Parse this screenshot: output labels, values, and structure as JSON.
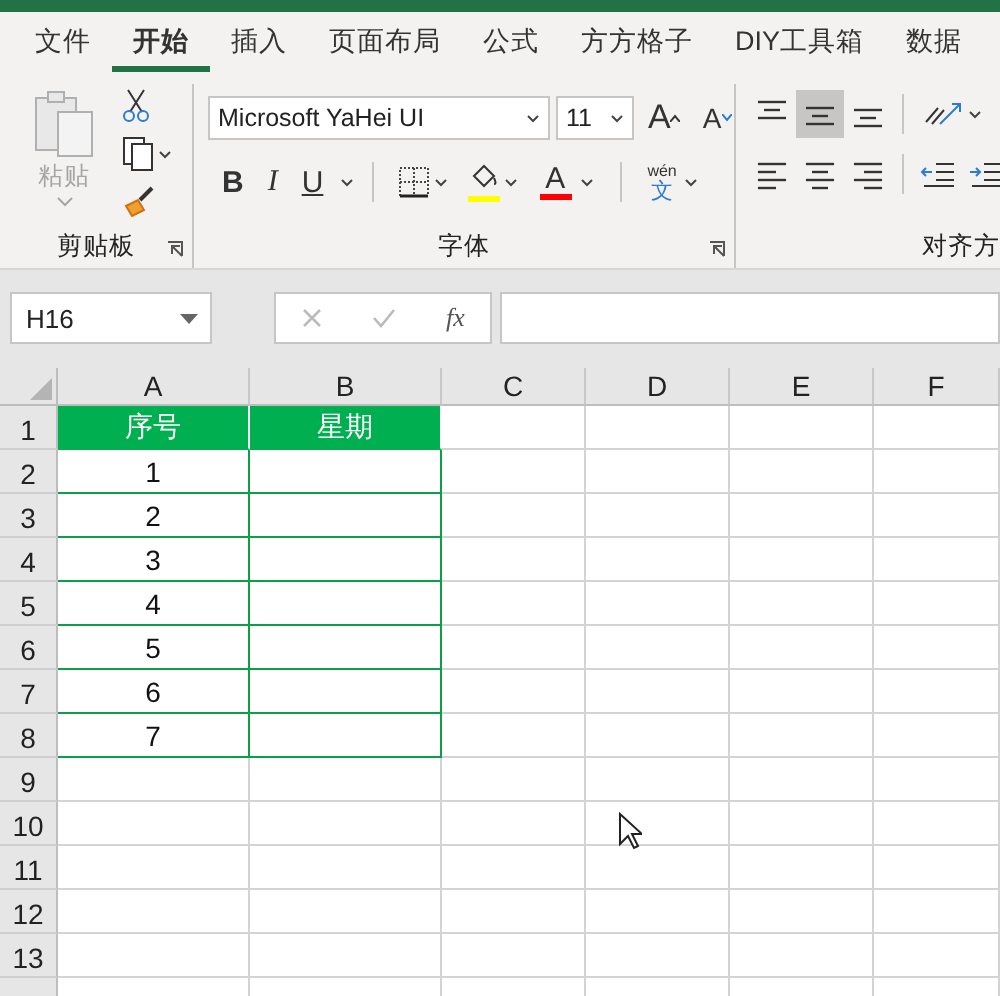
{
  "tabs": [
    {
      "label": "文件",
      "selected": false
    },
    {
      "label": "开始",
      "selected": true
    },
    {
      "label": "插入",
      "selected": false
    },
    {
      "label": "页面布局",
      "selected": false
    },
    {
      "label": "公式",
      "selected": false
    },
    {
      "label": "方方格子",
      "selected": false
    },
    {
      "label": "DIY工具箱",
      "selected": false
    },
    {
      "label": "数据",
      "selected": false
    }
  ],
  "clipboard": {
    "paste": {
      "label": "粘贴",
      "disabled": true
    },
    "title": "剪贴板"
  },
  "font": {
    "name": "Microsoft YaHei UI",
    "size": "11",
    "grow": "A",
    "shrink": "A",
    "bold": "B",
    "italic": "I",
    "underline": "U",
    "font_color": "A",
    "phonetic_top": "wén",
    "phonetic_main": "文",
    "title": "字体"
  },
  "alignment": {
    "vertical": [
      {
        "kind": "top",
        "selected": false
      },
      {
        "kind": "middle",
        "selected": true
      },
      {
        "kind": "bottom",
        "selected": false
      }
    ],
    "horizontal": [
      {
        "kind": "left",
        "selected": false
      },
      {
        "kind": "center",
        "selected": false
      },
      {
        "kind": "right",
        "selected": false
      }
    ],
    "title": "对齐方"
  },
  "formula_bar": {
    "name_box": "H16",
    "fx": "fx"
  },
  "sheet": {
    "columns": [
      "A",
      "B",
      "C",
      "D",
      "E",
      "F"
    ],
    "rows": [
      {
        "header": "1",
        "kind": "header",
        "cells": [
          "序号",
          "星期"
        ]
      },
      {
        "header": "2",
        "kind": "data",
        "cells": [
          "1",
          ""
        ]
      },
      {
        "header": "3",
        "kind": "data",
        "cells": [
          "2",
          ""
        ]
      },
      {
        "header": "4",
        "kind": "data",
        "cells": [
          "3",
          ""
        ]
      },
      {
        "header": "5",
        "kind": "data",
        "cells": [
          "4",
          ""
        ]
      },
      {
        "header": "6",
        "kind": "data",
        "cells": [
          "5",
          ""
        ]
      },
      {
        "header": "7",
        "kind": "data",
        "cells": [
          "6",
          ""
        ]
      },
      {
        "header": "8",
        "kind": "data",
        "cells": [
          "7",
          ""
        ]
      },
      {
        "header": "9",
        "kind": "empty",
        "cells": []
      },
      {
        "header": "10",
        "kind": "empty",
        "cells": []
      },
      {
        "header": "11",
        "kind": "empty",
        "cells": []
      },
      {
        "header": "12",
        "kind": "empty",
        "cells": []
      },
      {
        "header": "13",
        "kind": "empty",
        "cells": []
      }
    ]
  }
}
